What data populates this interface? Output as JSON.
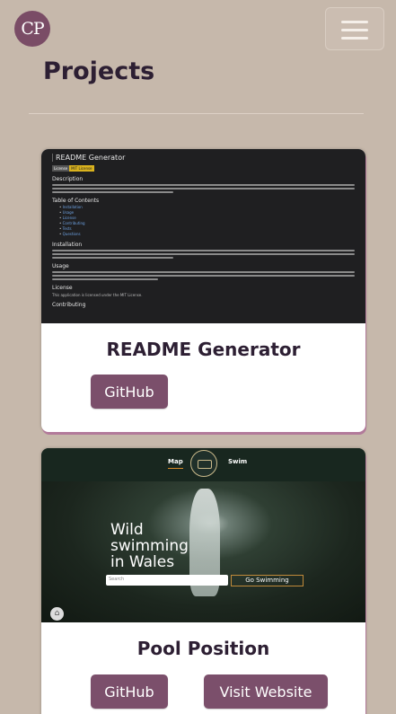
{
  "header": {
    "logo_text": "CP",
    "menu_icon": "hamburger-icon"
  },
  "page": {
    "title": "Projects"
  },
  "projects": [
    {
      "title": "README Generator",
      "github_label": "GitHub",
      "preview": {
        "heading": "README Generator",
        "badge_left": "License",
        "badge_right": "MIT License",
        "sections": [
          "Description",
          "Table of Contents",
          "Installation",
          "Usage",
          "License",
          "Contributing"
        ],
        "toc": [
          "Installation",
          "Usage",
          "License",
          "Contributing",
          "Tests",
          "Questions"
        ],
        "license_text": "This application is licensed under the MIT License."
      }
    },
    {
      "title": "Pool Position",
      "github_label": "GitHub",
      "website_label": "Visit Website",
      "preview": {
        "nav_left": "Map",
        "nav_right": "Swim",
        "hero_line1": "Wild",
        "hero_line2": "swimming",
        "hero_line3": "in Wales",
        "search_placeholder": "Search",
        "go_button": "Go Swimming"
      }
    }
  ],
  "colors": {
    "background": "#c6b8ab",
    "accent": "#7b4f6b",
    "heading": "#2d1f33"
  }
}
